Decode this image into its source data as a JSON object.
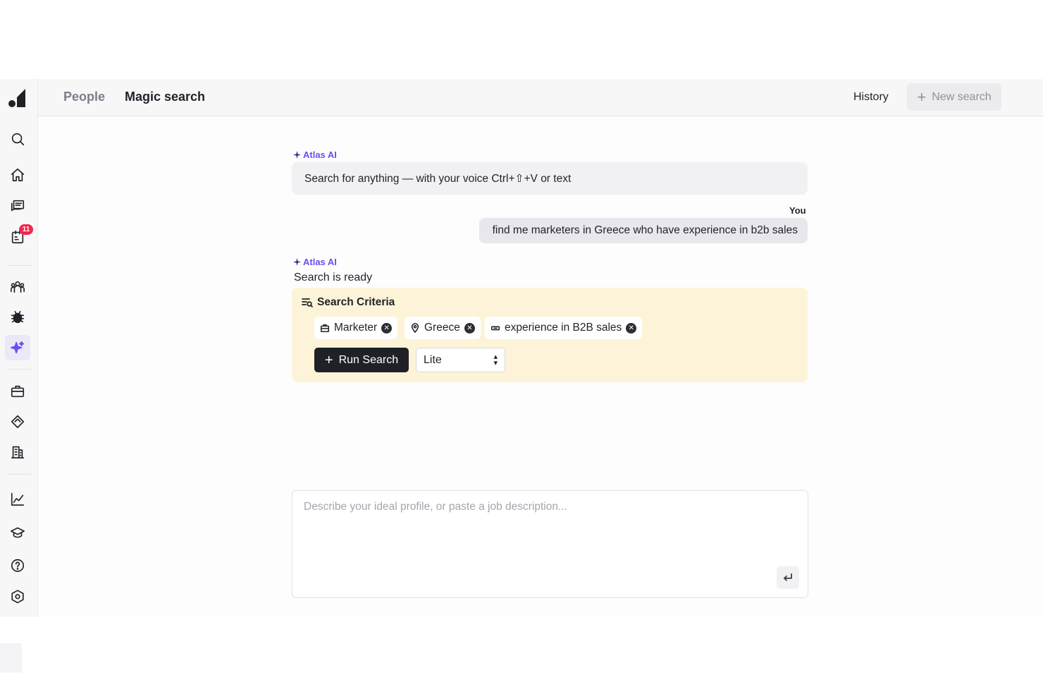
{
  "header": {
    "tabs": [
      {
        "label": "People"
      },
      {
        "label": "Magic search"
      }
    ],
    "history_label": "History",
    "new_search_label": "New search"
  },
  "sidebar": {
    "icons": [
      "logo-icon",
      "search-icon",
      "home-icon",
      "messages-icon",
      "tasks-icon",
      "people-icon",
      "bug-icon",
      "magic-sparkle-icon",
      "briefcase-icon",
      "deals-icon",
      "building-icon",
      "analytics-icon",
      "graduation-cap-icon",
      "help-icon",
      "settings-icon"
    ],
    "tasks_badge": "11"
  },
  "chat": {
    "ai_name": "Atlas AI",
    "intro_message": "Search for anything — with your voice Ctrl+⇧+V or text",
    "you_label": "You",
    "user_message": "find me marketers in Greece who have experience in b2b sales",
    "ready_message": "Search is ready"
  },
  "criteria": {
    "title": "Search Criteria",
    "chips": [
      {
        "label": "Marketer",
        "icon": "briefcase-icon"
      },
      {
        "label": "Greece",
        "icon": "location-pin-icon"
      },
      {
        "label": "experience in B2B sales",
        "icon": "skill-icon"
      }
    ],
    "run_label": "Run Search",
    "mode_selected": "Lite"
  },
  "composer": {
    "placeholder": "Describe your ideal profile, or paste a job description..."
  },
  "colors": {
    "accent": "#6b4ef0",
    "criteria_bg": "#fdf3d8",
    "badge": "#f0284a",
    "primary_button": "#1f2126"
  }
}
